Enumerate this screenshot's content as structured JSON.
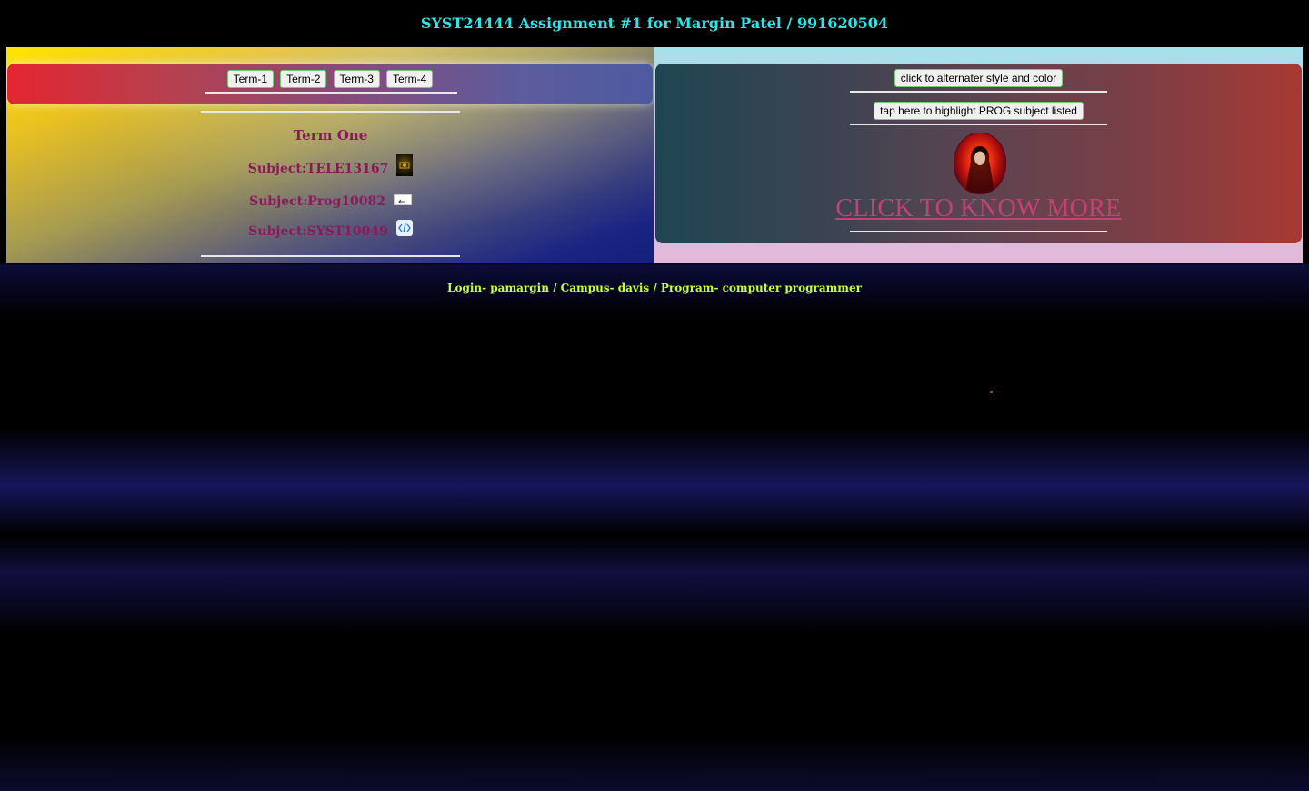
{
  "page": {
    "title": "SYST24444 Assignment #1 for Margin Patel / 991620504",
    "footer": "Login- pamargin / Campus- davis / Program- computer programmer"
  },
  "term_nav": {
    "buttons": [
      "Term-1",
      "Term-2",
      "Term-3",
      "Term-4"
    ]
  },
  "term_content": {
    "heading": "Term One",
    "subjects": [
      {
        "label": "Subject:TELE13167",
        "icon": "dark-thumbnail-icon"
      },
      {
        "label": "Subject:Prog10082",
        "icon": "arrow-icon"
      },
      {
        "label": "Subject:SYST10049",
        "icon": "code-icon"
      }
    ]
  },
  "controls": {
    "style_button": "click to alternater style and color",
    "highlight_button": "tap here to highlight PROG subject listed",
    "know_more_link": "CLICK TO KNOW MORE"
  },
  "colors": {
    "title": "#2ee6e6",
    "footer": "#c6ff3a",
    "subject_text": "#8b1a5a",
    "link": "#c54074"
  }
}
